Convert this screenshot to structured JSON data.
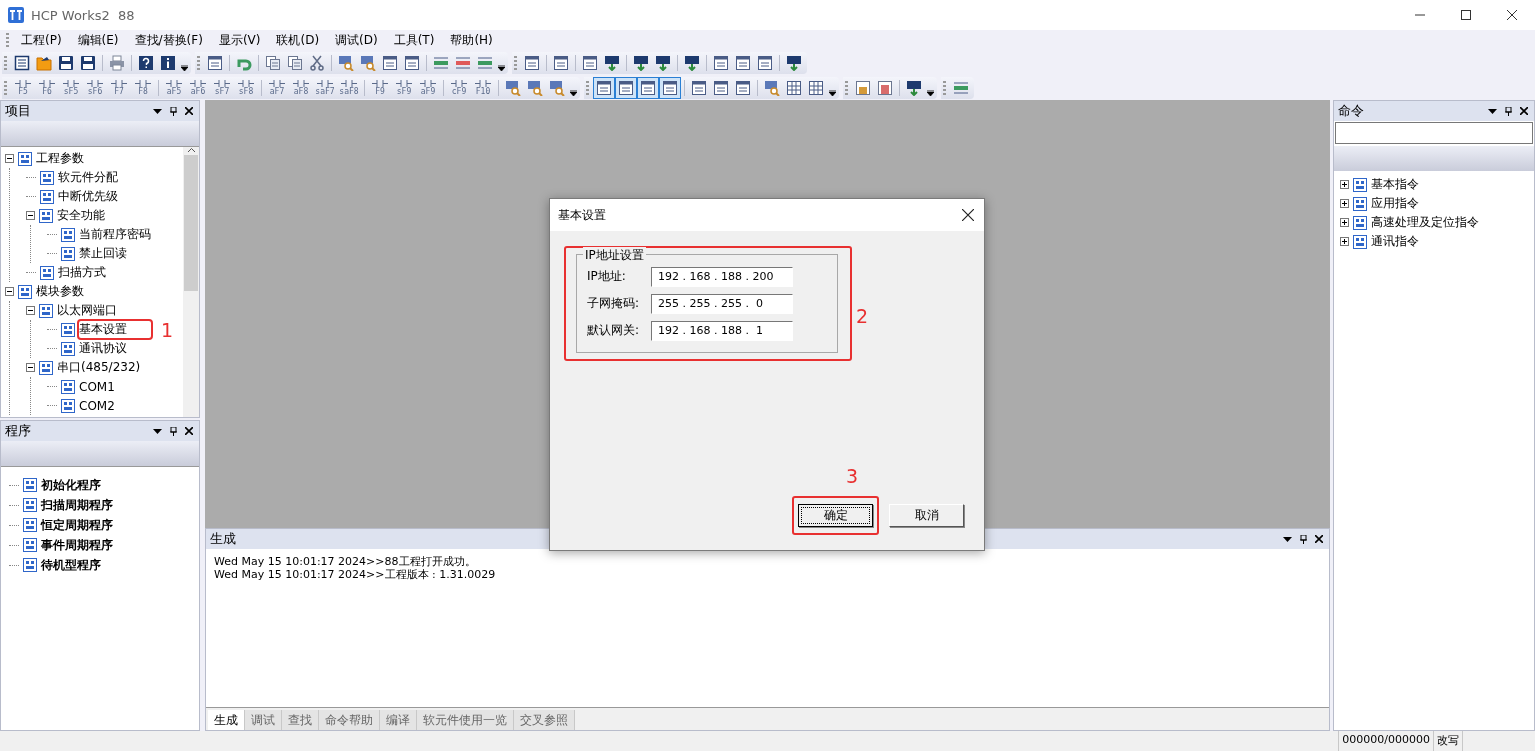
{
  "window": {
    "title": "HCP Works2  88"
  },
  "menu": [
    {
      "label": "工程(P)"
    },
    {
      "label": "编辑(E)"
    },
    {
      "label": "查找/替换(F)"
    },
    {
      "label": "显示(V)"
    },
    {
      "label": "联机(D)"
    },
    {
      "label": "调试(D)"
    },
    {
      "label": "工具(T)"
    },
    {
      "label": "帮助(H)"
    }
  ],
  "toolbars": [
    [
      {
        "items": [
          {
            "kind": "doc"
          },
          {
            "kind": "folder"
          },
          {
            "kind": "save"
          },
          {
            "kind": "save"
          },
          {
            "kind": "separator"
          },
          {
            "kind": "print"
          },
          {
            "kind": "separator"
          },
          {
            "kind": "help"
          },
          {
            "kind": "info"
          }
        ]
      },
      {
        "items": [
          {
            "kind": "window"
          },
          {
            "kind": "separator"
          },
          {
            "kind": "undo"
          },
          {
            "kind": "separator"
          },
          {
            "kind": "copy"
          },
          {
            "kind": "copy"
          },
          {
            "kind": "cut"
          },
          {
            "kind": "separator"
          },
          {
            "kind": "search"
          },
          {
            "kind": "search"
          },
          {
            "kind": "window"
          },
          {
            "kind": "window"
          },
          {
            "kind": "separator"
          },
          {
            "kind": "insert"
          },
          {
            "kind": "delete"
          },
          {
            "kind": "insert"
          }
        ]
      },
      {
        "items": [
          {
            "kind": "window"
          },
          {
            "kind": "separator"
          },
          {
            "kind": "window"
          },
          {
            "kind": "separator"
          },
          {
            "kind": "window"
          },
          {
            "kind": "plc"
          },
          {
            "kind": "separator"
          },
          {
            "kind": "plc"
          },
          {
            "kind": "plc"
          },
          {
            "kind": "separator"
          },
          {
            "kind": "plc"
          },
          {
            "kind": "separator"
          },
          {
            "kind": "window"
          },
          {
            "kind": "window"
          },
          {
            "kind": "window"
          },
          {
            "kind": "separator"
          },
          {
            "kind": "plc"
          }
        ]
      }
    ],
    [
      {
        "items": [
          {
            "kind": "key",
            "label": "F5"
          },
          {
            "kind": "key",
            "label": "F6"
          },
          {
            "kind": "key",
            "label": "sF5"
          },
          {
            "kind": "key",
            "label": "sF6"
          },
          {
            "kind": "key",
            "label": "F7"
          },
          {
            "kind": "key",
            "label": "F8"
          },
          {
            "kind": "separator"
          },
          {
            "kind": "key",
            "label": "aF5"
          },
          {
            "kind": "key",
            "label": "aF6"
          },
          {
            "kind": "key",
            "label": "sF7"
          },
          {
            "kind": "key",
            "label": "sF8"
          },
          {
            "kind": "separator"
          },
          {
            "kind": "key",
            "label": "aF7"
          },
          {
            "kind": "key",
            "label": "aF8"
          },
          {
            "kind": "key",
            "label": "saF7"
          },
          {
            "kind": "key",
            "label": "saF8"
          },
          {
            "kind": "separator"
          },
          {
            "kind": "key",
            "label": "F9"
          },
          {
            "kind": "key",
            "label": "sF9"
          },
          {
            "kind": "key",
            "label": "aF9"
          },
          {
            "kind": "separator"
          },
          {
            "kind": "key",
            "label": "cF9"
          },
          {
            "kind": "key",
            "label": "F10"
          },
          {
            "kind": "separator"
          },
          {
            "kind": "search"
          },
          {
            "kind": "search"
          },
          {
            "kind": "search"
          }
        ]
      },
      {
        "items": [
          {
            "kind": "window",
            "pressed": true
          },
          {
            "kind": "window",
            "pressed": true
          },
          {
            "kind": "window",
            "pressed": true
          },
          {
            "kind": "window",
            "pressed": true
          },
          {
            "kind": "separator"
          },
          {
            "kind": "window"
          },
          {
            "kind": "window"
          },
          {
            "kind": "window"
          },
          {
            "kind": "separator"
          },
          {
            "kind": "search"
          },
          {
            "kind": "grid"
          },
          {
            "kind": "grid"
          }
        ]
      },
      {
        "items": [
          {
            "kind": "lock"
          },
          {
            "kind": "trash"
          },
          {
            "kind": "separator"
          },
          {
            "kind": "plc"
          }
        ]
      },
      {
        "items": [
          {
            "kind": "insert"
          }
        ]
      }
    ]
  ],
  "project_panel": {
    "title": "项目",
    "tree": [
      {
        "label": "工程参数",
        "expanded": true,
        "children": [
          {
            "label": "软元件分配"
          },
          {
            "label": "中断优先级"
          },
          {
            "label": "安全功能",
            "expanded": true,
            "children": [
              {
                "label": "当前程序密码"
              },
              {
                "label": "禁止回读"
              }
            ]
          },
          {
            "label": "扫描方式"
          }
        ]
      },
      {
        "label": "模块参数",
        "expanded": true,
        "children": [
          {
            "label": "以太网端口",
            "expanded": true,
            "children": [
              {
                "label": "基本设置",
                "highlighted": true,
                "annotation": "1"
              },
              {
                "label": "通讯协议"
              }
            ]
          },
          {
            "label": "串口(485/232)",
            "expanded": true,
            "children": [
              {
                "label": "COM1"
              },
              {
                "label": "COM2"
              }
            ]
          }
        ]
      }
    ]
  },
  "program_panel": {
    "title": "程序",
    "items": [
      "初始化程序",
      "扫描周期程序",
      "恒定周期程序",
      "事件周期程序",
      "待机型程序"
    ]
  },
  "command_panel": {
    "title": "命令",
    "tree": [
      {
        "label": "基本指令",
        "expanded": false
      },
      {
        "label": "应用指令",
        "expanded": false
      },
      {
        "label": "高速处理及定位指令",
        "expanded": false
      },
      {
        "label": "通讯指令",
        "expanded": false
      }
    ]
  },
  "output_panel": {
    "title": "生成",
    "lines": [
      "Wed May 15 10:01:17 2024>>88工程打开成功。",
      "Wed May 15 10:01:17 2024>>工程版本 : 1.31.0029"
    ],
    "tabs": [
      {
        "label": "生成",
        "selected": true
      },
      {
        "label": "调试",
        "selected": false
      },
      {
        "label": "查找",
        "selected": false
      },
      {
        "label": "命令帮助",
        "selected": false
      },
      {
        "label": "编译",
        "selected": false
      },
      {
        "label": "软元件使用一览",
        "selected": false
      },
      {
        "label": "交叉参照",
        "selected": false
      }
    ]
  },
  "dialog": {
    "title": "基本设置",
    "group": {
      "title": "IP地址设置",
      "highlighted": true,
      "annotation": "2",
      "fields": [
        {
          "label": "IP地址:",
          "value": "192 . 168 . 188 . 200"
        },
        {
          "label": "子网掩码:",
          "value": "255 . 255 . 255 .  0"
        },
        {
          "label": "默认网关:",
          "value": "192 . 168 . 188 .  1"
        }
      ]
    },
    "buttons": [
      {
        "label": "确定",
        "default": true,
        "highlighted": true,
        "annotation": "3"
      },
      {
        "label": "取消",
        "default": false,
        "highlighted": false
      }
    ]
  },
  "status_bar": {
    "position": "000000/000000",
    "mode": "改写"
  }
}
